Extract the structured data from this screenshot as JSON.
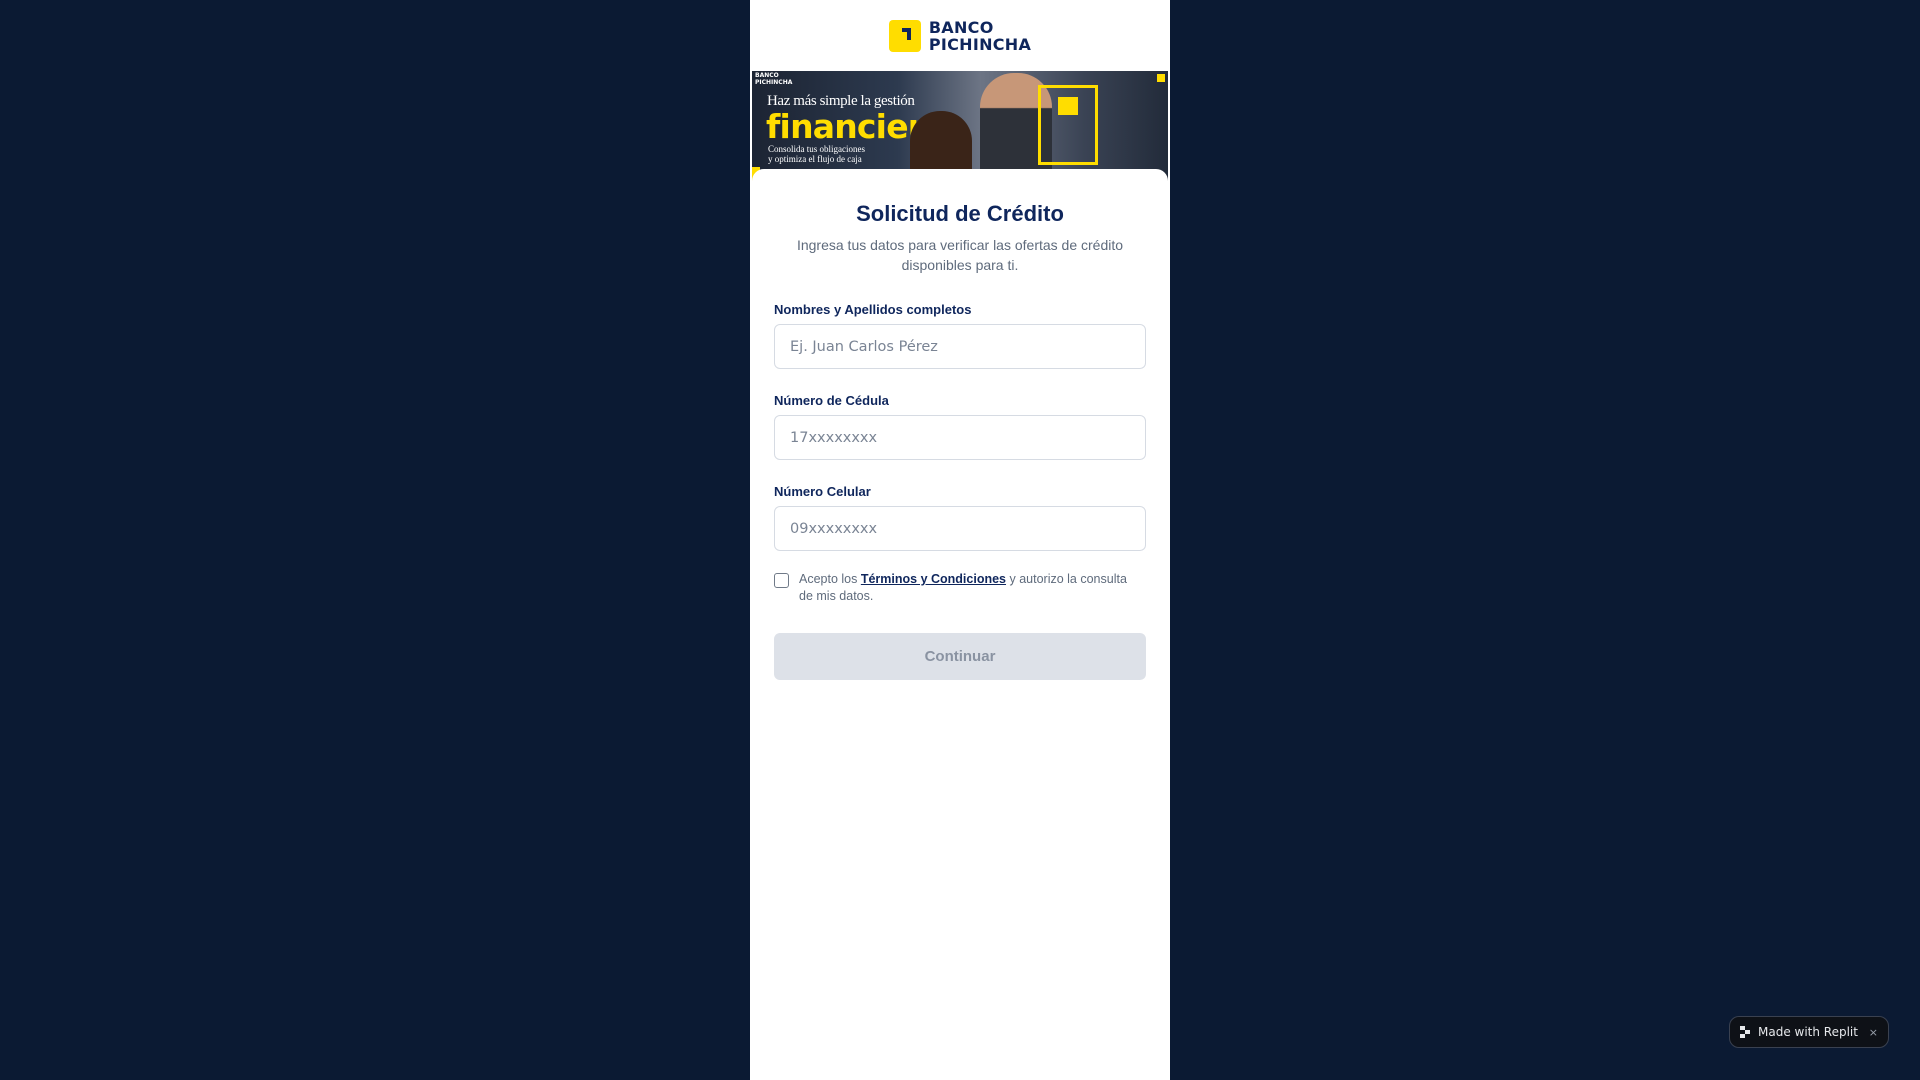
{
  "brand": {
    "line1": "BANCO",
    "line2": "PICHINCHA",
    "primary_color": "#0f265c",
    "accent_color": "#ffdd00"
  },
  "banner": {
    "brand_line1": "BANCO",
    "brand_line2": "PICHINCHA",
    "headline_small": "Haz más simple la gestión",
    "headline_big": "financiera",
    "tagline_line1": "Consolida tus obligaciones",
    "tagline_line2": "y optimiza el flujo de caja"
  },
  "form": {
    "title": "Solicitud de Crédito",
    "subtitle": "Ingresa tus datos para verificar las ofertas de crédito disponibles para ti.",
    "fields": [
      {
        "label": "Nombres y Apellidos completos",
        "placeholder": "Ej. Juan Carlos Pérez",
        "value": ""
      },
      {
        "label": "Número de Cédula",
        "placeholder": "17xxxxxxxx",
        "value": ""
      },
      {
        "label": "Número Celular",
        "placeholder": "09xxxxxxxx",
        "value": ""
      }
    ],
    "terms": {
      "prefix": "Acepto los ",
      "link": "Términos y Condiciones",
      "suffix": " y autorizo la consulta de mis datos."
    },
    "submit_label": "Continuar"
  },
  "replit_badge": {
    "label": "Made with Replit",
    "close": "×"
  }
}
